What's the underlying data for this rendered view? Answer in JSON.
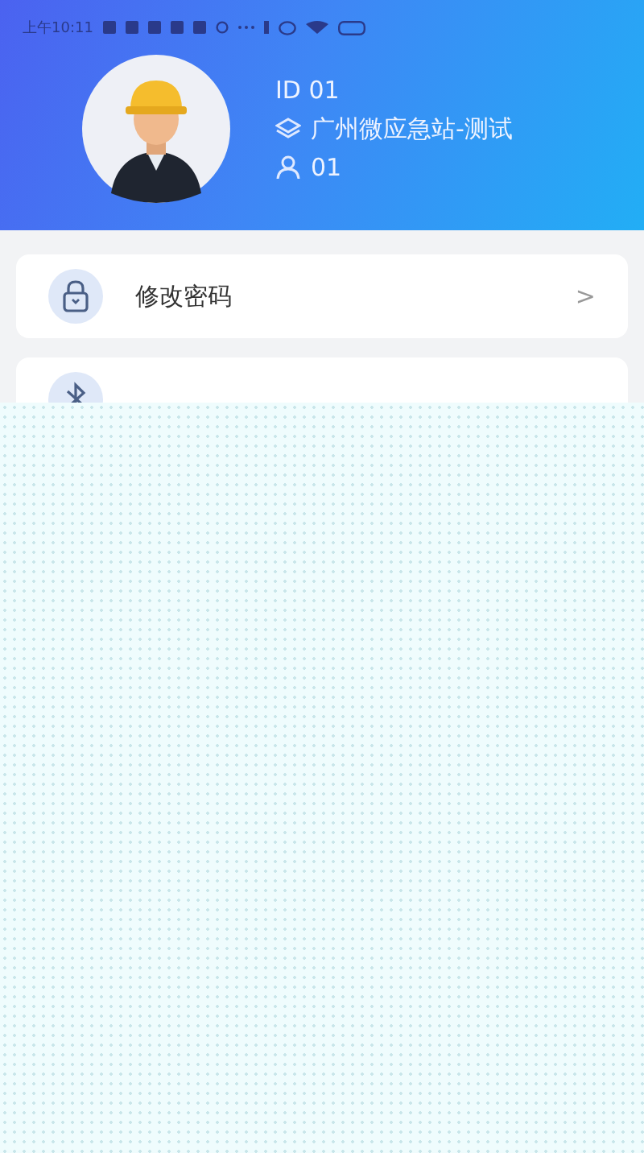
{
  "status_bar": {
    "time": "上午10:11"
  },
  "profile": {
    "id": "ID 01",
    "station": "广州微应急站-测试",
    "user": "01"
  },
  "menu": [
    {
      "kind": "lock",
      "label": "修改密码",
      "chevron": ">"
    },
    {
      "kind": "bluetooth"
    }
  ]
}
